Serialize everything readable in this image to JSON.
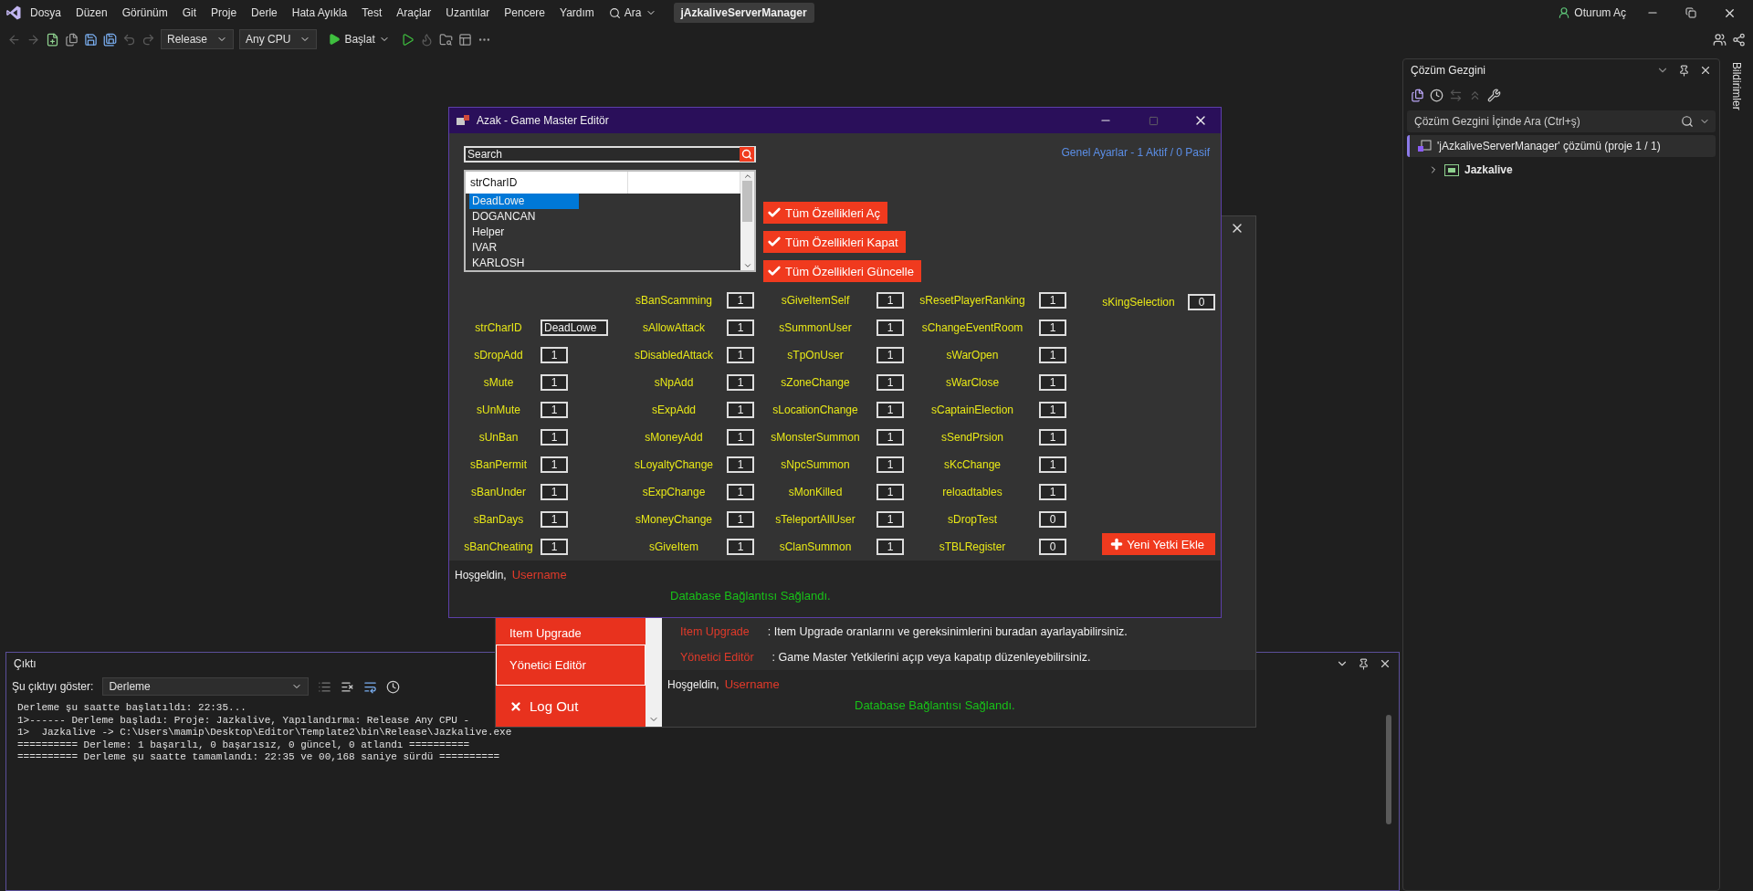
{
  "menu_bar": {
    "items": [
      "Dosya",
      "Düzen",
      "Görünüm",
      "Git",
      "Proje",
      "Derle",
      "Hata Ayıkla",
      "Test",
      "Araçlar",
      "Uzantılar",
      "Pencere",
      "Yardım"
    ],
    "search": "Ara",
    "title": "jAzkaliveServerManager",
    "sign_in": "Oturum Aç"
  },
  "toolbar": {
    "configuration": "Release",
    "platform": "Any CPU",
    "start": "Başlat"
  },
  "output_panel": {
    "title": "Çıktı",
    "show_label": "Şu çıktıyı göster:",
    "source": "Derleme",
    "lines": [
      "Derleme şu saatte başlatıldı: 22:35...",
      "1>------ Derleme başladı: Proje: Jazkalive, Yapılandırma: Release Any CPU -",
      "1>  Jazkalive -> C:\\Users\\mamip\\Desktop\\Editor\\Template2\\bin\\Release\\Jazkalive.exe",
      "========== Derleme: 1 başarılı, 0 başarısız, 0 güncel, 0 atlandı ==========",
      "========== Derleme şu saatte tamamlandı: 22:35 ve 00,168 saniye sürdü =========="
    ]
  },
  "solution_explorer": {
    "title": "Çözüm Gezgini",
    "search": {
      "placeholder": "Çözüm Gezgini İçinde Ara (Ctrl+ş)"
    },
    "tree": [
      {
        "label": "'jAzkaliveServerManager' çözümü (proje 1 / 1)",
        "selected": true,
        "children": [
          {
            "label": "Jazkalive",
            "selected": false,
            "expanded": false
          }
        ]
      }
    ]
  },
  "side_tab": "Bildirimler",
  "background_window": {
    "menu": [
      {
        "label": "Item Upgrade",
        "kind": "page",
        "selected": false
      },
      {
        "label": "Yönetici Editör",
        "kind": "page",
        "selected": true
      },
      {
        "label": "Log Out",
        "kind": "logout",
        "selected": false
      }
    ],
    "descriptions": [
      {
        "name": "Item Upgrade",
        "text": ": Item Upgrade oranlarını ve gereksinimlerini buradan ayarlayabilirsiniz."
      },
      {
        "name": "Yönetici Editör",
        "text": ": Game Master Yetkilerini açıp veya kapatıp düzenleyebilirsiniz."
      }
    ],
    "greeting": "Hoşgeldin,",
    "username": "Username",
    "status": "Database Bağlantısı Sağlandı."
  },
  "dialog": {
    "title": "Azak - Game Master Editör",
    "search": {
      "placeholder": "Search"
    },
    "list": {
      "column": "strCharID",
      "items": [
        {
          "label": "DeadLowe",
          "selected": true
        },
        {
          "label": "DOGANCAN",
          "selected": false
        },
        {
          "label": "Helper",
          "selected": false
        },
        {
          "label": "IVAR",
          "selected": false
        },
        {
          "label": "KARLOSH",
          "selected": false
        }
      ]
    },
    "actions": [
      "Tüm Özellikleri Aç",
      "Tüm Özellikleri Kapat",
      "Tüm Özellikleri Güncelle"
    ],
    "summary": "Genel Ayarlar - 1 Aktif / 0 Pasif",
    "field_columns": [
      [
        {
          "label": "strCharID",
          "value": "DeadLowe",
          "kind": "text"
        },
        {
          "label": "sDropAdd",
          "value": "1",
          "kind": "number"
        },
        {
          "label": "sMute",
          "value": "1",
          "kind": "number"
        },
        {
          "label": "sUnMute",
          "value": "1",
          "kind": "number"
        },
        {
          "label": "sUnBan",
          "value": "1",
          "kind": "number"
        },
        {
          "label": "sBanPermit",
          "value": "1",
          "kind": "number"
        },
        {
          "label": "sBanUnder",
          "value": "1",
          "kind": "number"
        },
        {
          "label": "sBanDays",
          "value": "1",
          "kind": "number"
        },
        {
          "label": "sBanCheating",
          "value": "1",
          "kind": "number"
        }
      ],
      [
        {
          "label": "sBanScamming",
          "value": "1",
          "kind": "number"
        },
        {
          "label": "sAllowAttack",
          "value": "1",
          "kind": "number"
        },
        {
          "label": "sDisabledAttack",
          "value": "1",
          "kind": "number"
        },
        {
          "label": "sNpAdd",
          "value": "1",
          "kind": "number"
        },
        {
          "label": "sExpAdd",
          "value": "1",
          "kind": "number"
        },
        {
          "label": "sMoneyAdd",
          "value": "1",
          "kind": "number"
        },
        {
          "label": "sLoyaltyChange",
          "value": "1",
          "kind": "number"
        },
        {
          "label": "sExpChange",
          "value": "1",
          "kind": "number"
        },
        {
          "label": "sMoneyChange",
          "value": "1",
          "kind": "number"
        },
        {
          "label": "sGiveItem",
          "value": "1",
          "kind": "number"
        }
      ],
      [
        {
          "label": "sGiveItemSelf",
          "value": "1",
          "kind": "number"
        },
        {
          "label": "sSummonUser",
          "value": "1",
          "kind": "number"
        },
        {
          "label": "sTpOnUser",
          "value": "1",
          "kind": "number"
        },
        {
          "label": "sZoneChange",
          "value": "1",
          "kind": "number"
        },
        {
          "label": "sLocationChange",
          "value": "1",
          "kind": "number"
        },
        {
          "label": "sMonsterSummon",
          "value": "1",
          "kind": "number"
        },
        {
          "label": "sNpcSummon",
          "value": "1",
          "kind": "number"
        },
        {
          "label": "sMonKilled",
          "value": "1",
          "kind": "number"
        },
        {
          "label": "sTeleportAllUser",
          "value": "1",
          "kind": "number"
        },
        {
          "label": "sClanSummon",
          "value": "1",
          "kind": "number"
        }
      ],
      [
        {
          "label": "sResetPlayerRanking",
          "value": "1",
          "kind": "number"
        },
        {
          "label": "sChangeEventRoom",
          "value": "1",
          "kind": "number"
        },
        {
          "label": "sWarOpen",
          "value": "1",
          "kind": "number"
        },
        {
          "label": "sWarClose",
          "value": "1",
          "kind": "number"
        },
        {
          "label": "sCaptainElection",
          "value": "1",
          "kind": "number"
        },
        {
          "label": "sSendPrsion",
          "value": "1",
          "kind": "number"
        },
        {
          "label": "sKcChange",
          "value": "1",
          "kind": "number"
        },
        {
          "label": "reloadtables",
          "value": "1",
          "kind": "number"
        },
        {
          "label": "sDropTest",
          "value": "0",
          "kind": "number"
        },
        {
          "label": "sTBLRegister",
          "value": "0",
          "kind": "number"
        }
      ]
    ],
    "extra_field": {
      "label": "sKingSelection",
      "value": "0"
    },
    "add_button": "Yeni Yetki Ekle",
    "greeting": "Hoşgeldin,",
    "username": "Username",
    "status": "Database Bağlantısı Sağlandı."
  }
}
